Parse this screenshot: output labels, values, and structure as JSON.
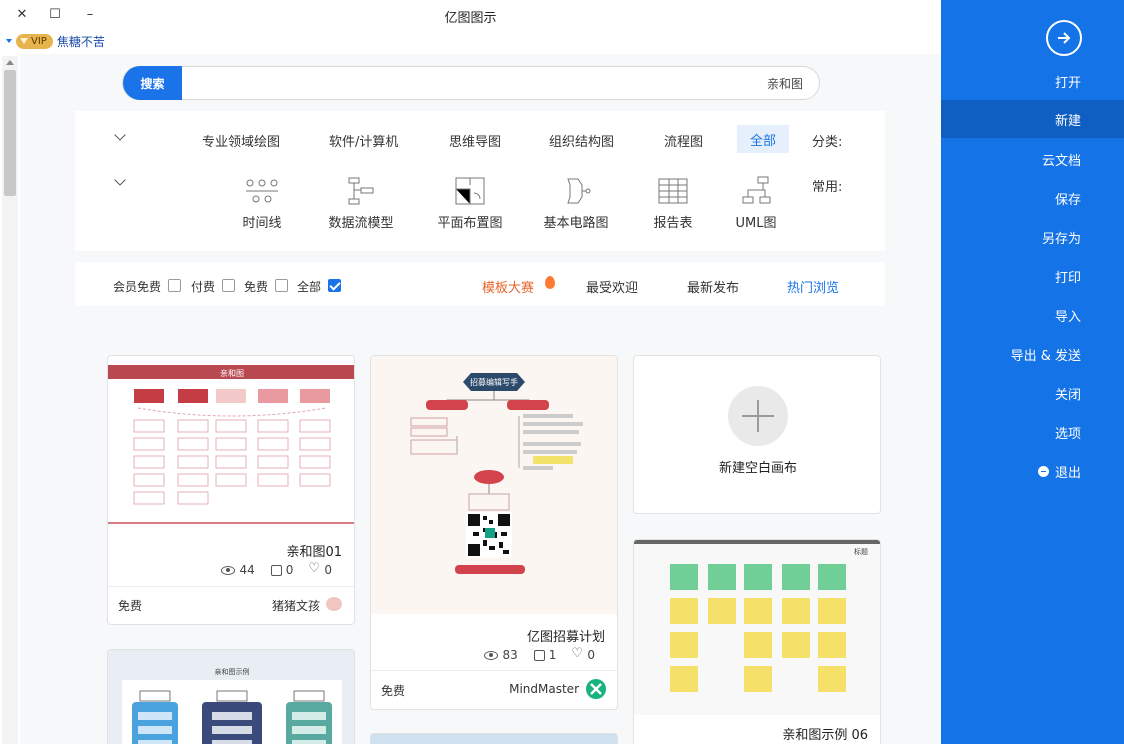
{
  "window": {
    "title": "亿图图示",
    "close": "✕",
    "maximize": "☐",
    "minimize": "–"
  },
  "user": {
    "vip": "VIP",
    "name": "焦糖不苦"
  },
  "sidebar": {
    "items": [
      {
        "label": "打开"
      },
      {
        "label": "新建"
      },
      {
        "label": "云文档"
      },
      {
        "label": "保存"
      },
      {
        "label": "另存为"
      },
      {
        "label": "打印"
      },
      {
        "label": "导入"
      },
      {
        "label": "导出 & 发送"
      },
      {
        "label": "关闭"
      },
      {
        "label": "选项"
      },
      {
        "label": "退出"
      }
    ]
  },
  "search": {
    "button": "搜索",
    "query": "亲和图"
  },
  "categories": {
    "label": "分类:",
    "items": [
      "全部",
      "流程图",
      "组织结构图",
      "思维导图",
      "软件/计算机",
      "专业领域绘图"
    ],
    "active": "全部"
  },
  "common": {
    "label": "常用:",
    "items": [
      "UML图",
      "报告表",
      "基本电路图",
      "平面布置图",
      "数据流模型",
      "时间线"
    ]
  },
  "sort": {
    "hot": "热门浏览",
    "latest": "最新发布",
    "popular": "最受欢迎",
    "contest": "模板大赛"
  },
  "filters": {
    "all": "全部",
    "free": "免费",
    "paid": "付费",
    "member_free": "会员免费"
  },
  "cards": {
    "blank": {
      "label": "新建空白画布"
    },
    "c1": {
      "title": "亲和图01",
      "views": "44",
      "likes": "0",
      "hearts": "0",
      "author": "猪猪文孩",
      "price": "免费",
      "thumb_title": "亲和图"
    },
    "c2": {
      "title": "亿图招募计划",
      "views": "83",
      "likes": "1",
      "hearts": "0",
      "author": "MindMaster",
      "price": "免费",
      "thumb_title": "招募编辑写手"
    },
    "c3": {
      "title": "亲和图示例 06",
      "thumb_title": "标题"
    },
    "c4": {
      "thumb_title": "亲和图示例"
    }
  },
  "colors": {
    "accent": "#1a73e8",
    "sidebar": "#1473e6",
    "vip": "#e7b34c"
  }
}
